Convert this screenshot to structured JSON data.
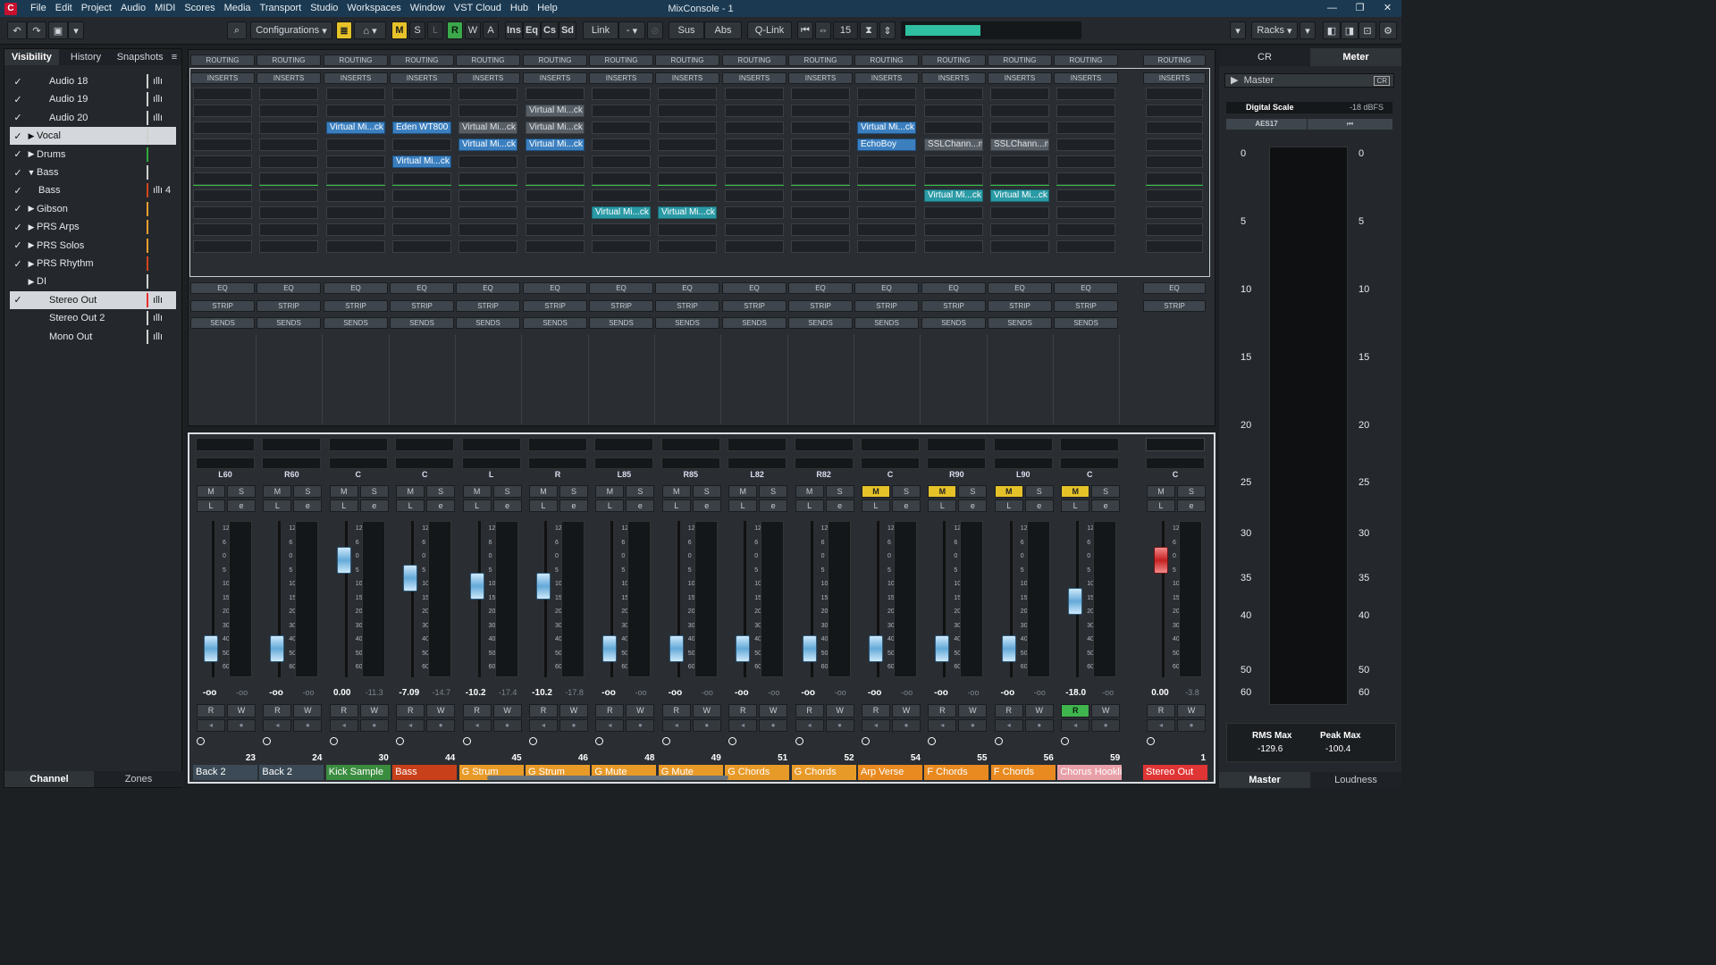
{
  "window": {
    "title": "MixConsole - 1"
  },
  "menu": [
    "File",
    "Edit",
    "Project",
    "Audio",
    "MIDI",
    "Scores",
    "Media",
    "Transport",
    "Studio",
    "Workspaces",
    "Window",
    "VST Cloud",
    "Hub",
    "Help"
  ],
  "toolbar": {
    "configurations": "Configurations",
    "m": "M",
    "s": "S",
    "l": "L",
    "r": "R",
    "w": "W",
    "a": "A",
    "ins": "Ins",
    "eq": "Eq",
    "cs": "Cs",
    "sd": "Sd",
    "link": "Link",
    "link_val": "-",
    "sus": "Sus",
    "abs": "Abs",
    "qlink": "Q-Link",
    "counter": "15",
    "racks": "Racks"
  },
  "left": {
    "tabs": [
      "Visibility",
      "History",
      "Snapshots"
    ],
    "bottom_tabs": [
      "Channel",
      "Zones"
    ],
    "items": [
      {
        "label": "Audio 18",
        "checked": "✓",
        "tri": "",
        "color": "#d0d0d0",
        "wave": "ıllı"
      },
      {
        "label": "Audio 19",
        "checked": "✓",
        "tri": "",
        "color": "#d0d0d0",
        "wave": "ıllı"
      },
      {
        "label": "Audio 20",
        "checked": "✓",
        "tri": "",
        "color": "#d0d0d0",
        "wave": "ıllı"
      },
      {
        "label": "Vocal",
        "checked": "✓",
        "tri": "▶",
        "color": "#d0d0d0",
        "wave": ""
      },
      {
        "label": "Drums",
        "checked": "✓",
        "tri": "▶",
        "color": "#34a83f",
        "wave": ""
      },
      {
        "label": "Bass",
        "checked": "✓",
        "tri": "▼",
        "color": "#d0d0d0",
        "wave": ""
      },
      {
        "label": "Bass",
        "checked": "✓",
        "tri": "",
        "color": "#d2451d",
        "wave": "ıllı 4"
      },
      {
        "label": "Gibson",
        "checked": "✓",
        "tri": "▶",
        "color": "#f0a030",
        "wave": ""
      },
      {
        "label": "PRS Arps",
        "checked": "✓",
        "tri": "▶",
        "color": "#f0a030",
        "wave": ""
      },
      {
        "label": "PRS Solos",
        "checked": "✓",
        "tri": "▶",
        "color": "#f0a030",
        "wave": ""
      },
      {
        "label": "PRS Rhythm",
        "checked": "✓",
        "tri": "▶",
        "color": "#d2451d",
        "wave": ""
      },
      {
        "label": "DI",
        "checked": "",
        "tri": "▶",
        "color": "#d0d0d0",
        "wave": ""
      },
      {
        "label": "Stereo Out",
        "checked": "✓",
        "tri": "",
        "color": "#e83030",
        "wave": "ıllı"
      },
      {
        "label": "Stereo Out 2",
        "checked": "",
        "tri": "",
        "color": "#d0d0d0",
        "wave": "ıllı"
      },
      {
        "label": "Mono Out",
        "checked": "",
        "tri": "",
        "color": "#d0d0d0",
        "wave": "ıllı"
      }
    ]
  },
  "rack": {
    "routing": "ROUTING",
    "inserts": "INSERTS",
    "eq": "EQ",
    "strip": "STRIP",
    "sends": "SENDS",
    "plugins": [
      {
        "col": 2,
        "slot": 2,
        "name": "Virtual Mi...ck",
        "style": "blue"
      },
      {
        "col": 3,
        "slot": 2,
        "name": "Eden WT800",
        "style": "blue"
      },
      {
        "col": 3,
        "slot": 4,
        "name": "Virtual Mi...ck",
        "style": "blue"
      },
      {
        "col": 4,
        "slot": 2,
        "name": "Virtual Mi...ck",
        "style": "dim"
      },
      {
        "col": 4,
        "slot": 3,
        "name": "Virtual Mi...ck",
        "style": "blue"
      },
      {
        "col": 5,
        "slot": 1,
        "name": "Virtual Mi...ck",
        "style": "dim"
      },
      {
        "col": 5,
        "slot": 2,
        "name": "Virtual Mi...ck",
        "style": "dim"
      },
      {
        "col": 5,
        "slot": 3,
        "name": "Virtual Mi...ck",
        "style": "blue"
      },
      {
        "col": 6,
        "slot": 7,
        "name": "Virtual Mi...ck",
        "style": "tl"
      },
      {
        "col": 7,
        "slot": 7,
        "name": "Virtual Mi...ck",
        "style": "tl"
      },
      {
        "col": 10,
        "slot": 2,
        "name": "Virtual Mi...ck",
        "style": "blue"
      },
      {
        "col": 10,
        "slot": 3,
        "name": "EchoBoy",
        "style": "blue"
      },
      {
        "col": 11,
        "slot": 3,
        "name": "SSLChann...no",
        "style": "dim"
      },
      {
        "col": 11,
        "slot": 6,
        "name": "Virtual Mi...ck",
        "style": "tl"
      },
      {
        "col": 12,
        "slot": 3,
        "name": "SSLChann...no",
        "style": "dim"
      },
      {
        "col": 12,
        "slot": 6,
        "name": "Virtual Mi...ck",
        "style": "tl"
      }
    ],
    "eq_active": [
      4,
      5,
      6,
      7,
      8,
      9
    ]
  },
  "channels": [
    {
      "name": "Back 2",
      "num": "23",
      "pan": "L60",
      "vol": "-oo",
      "peak": "-oo",
      "color": "#3b4a56",
      "m": false,
      "r": false,
      "fader": 0.88
    },
    {
      "name": "Back 2",
      "num": "24",
      "pan": "R60",
      "vol": "-oo",
      "peak": "-oo",
      "color": "#3b4a56",
      "m": false,
      "r": false,
      "fader": 0.88
    },
    {
      "name": "Kick Sample",
      "num": "30",
      "pan": "C",
      "vol": "0.00",
      "peak": "-11.3",
      "color": "#3a8c3f",
      "m": false,
      "r": false,
      "fader": 0.2
    },
    {
      "name": "Bass",
      "num": "44",
      "pan": "C",
      "vol": "-7.09",
      "peak": "-14.7",
      "color": "#c8401a",
      "m": false,
      "r": false,
      "fader": 0.34
    },
    {
      "name": "G Strum",
      "num": "45",
      "pan": "L",
      "vol": "-10.2",
      "peak": "-17.4",
      "color": "#e89a28",
      "m": false,
      "r": false,
      "fader": 0.4
    },
    {
      "name": "G Strum",
      "num": "46",
      "pan": "R",
      "vol": "-10.2",
      "peak": "-17.8",
      "color": "#e89a28",
      "m": false,
      "r": false,
      "fader": 0.4
    },
    {
      "name": "G Mute",
      "num": "48",
      "pan": "L85",
      "vol": "-oo",
      "peak": "-oo",
      "color": "#e89a28",
      "m": false,
      "r": false,
      "fader": 0.88
    },
    {
      "name": "G Mute",
      "num": "49",
      "pan": "R85",
      "vol": "-oo",
      "peak": "-oo",
      "color": "#e89a28",
      "m": false,
      "r": false,
      "fader": 0.88
    },
    {
      "name": "G Chords",
      "num": "51",
      "pan": "L82",
      "vol": "-oo",
      "peak": "-oo",
      "color": "#e89a28",
      "m": false,
      "r": false,
      "fader": 0.88
    },
    {
      "name": "G Chords",
      "num": "52",
      "pan": "R82",
      "vol": "-oo",
      "peak": "-oo",
      "color": "#e89a28",
      "m": false,
      "r": false,
      "fader": 0.88
    },
    {
      "name": "Arp Verse",
      "num": "54",
      "pan": "C",
      "vol": "-oo",
      "peak": "-oo",
      "color": "#e88a20",
      "m": true,
      "r": false,
      "fader": 0.88
    },
    {
      "name": "F Chords",
      "num": "55",
      "pan": "R90",
      "vol": "-oo",
      "peak": "-oo",
      "color": "#e88a20",
      "m": true,
      "r": false,
      "fader": 0.88
    },
    {
      "name": "F Chords",
      "num": "56",
      "pan": "L90",
      "vol": "-oo",
      "peak": "-oo",
      "color": "#e88a20",
      "m": true,
      "r": false,
      "fader": 0.88
    },
    {
      "name": "Chorus Hooklin",
      "num": "59",
      "pan": "C",
      "vol": "-18.0",
      "peak": "-oo",
      "color": "#e8a0a8",
      "m": true,
      "r": true,
      "fader": 0.52
    }
  ],
  "master": {
    "name": "Stereo Out",
    "num": "1",
    "pan": "C",
    "vol": "0.00",
    "peak": "-3.8",
    "color": "#e03535",
    "fader": 0.2
  },
  "scale": [
    "12",
    "6",
    "0",
    "5",
    "10",
    "15",
    "20",
    "30",
    "40",
    "50",
    "60"
  ],
  "right": {
    "tabs": [
      "CR",
      "Meter"
    ],
    "master": "Master",
    "cr_badge": "CR",
    "digital_scale": "Digital Scale",
    "dbfs": "-18 dBFS",
    "aes": "AES17",
    "scale": [
      "0",
      "5",
      "10",
      "15",
      "20",
      "25",
      "30",
      "35",
      "40",
      "50",
      "60"
    ],
    "rms_label": "RMS Max",
    "rms_val": "-129.6",
    "peak_label": "Peak Max",
    "peak_val": "-100.4",
    "bottom_tabs": [
      "Master",
      "Loudness"
    ]
  }
}
